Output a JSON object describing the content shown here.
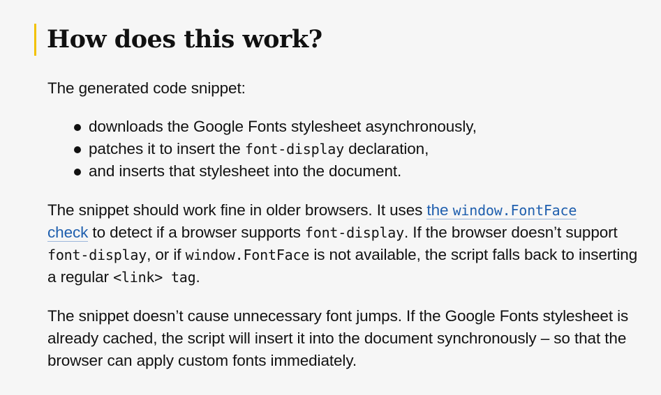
{
  "heading": "How does this work?",
  "intro": "The generated code snippet:",
  "bullets": [
    {
      "before": "downloads the Google Fonts stylesheet asynchronously,",
      "code": "",
      "after": ""
    },
    {
      "before": "patches it to insert the ",
      "code": "font-display",
      "after": " declaration,"
    },
    {
      "before": "and inserts that stylesheet into the document.",
      "code": "",
      "after": ""
    }
  ],
  "para1": {
    "line1_text": "The snippet should work fine in older browsers. It uses ",
    "link_text_a": "the ",
    "link_code": "window.FontFace",
    "link_text_b": "check",
    "text2": " to detect if a browser supports ",
    "code1": "font-display",
    "text3": ". If the browser doesn’t support ",
    "code2": "font-display",
    "text4": ", or if ",
    "code3": "window.FontFace",
    "text5": " is not available, the script falls back to inserting a regular ",
    "code4": "<link> tag",
    "text6": "."
  },
  "para2": "The snippet doesn’t cause unnecessary font jumps. If the Google Fonts stylesheet is already cached, the script will insert it into the document synchronously – so that the browser can apply custom fonts immediately."
}
